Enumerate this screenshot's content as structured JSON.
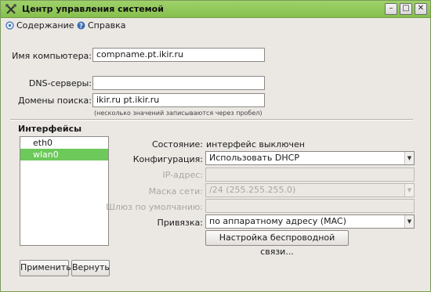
{
  "window": {
    "title": "Центр управления системой",
    "buttons": {
      "minimize": "–",
      "maximize": "□",
      "close": "✕"
    }
  },
  "menu": {
    "items": [
      {
        "label": "Содержание",
        "icon": "contents-icon"
      },
      {
        "label": "Справка",
        "icon": "help-icon"
      }
    ]
  },
  "form": {
    "hostname_label": "Имя компьютера:",
    "hostname_value": "compname.pt.ikir.ru",
    "dns_label": "DNS-серверы:",
    "dns_value": "",
    "search_label": "Домены поиска:",
    "search_value": "ikir.ru pt.ikir.ru",
    "search_hint": "(несколько значений записываются через пробел)"
  },
  "interfaces": {
    "title": "Интерфейсы",
    "items": [
      "eth0",
      "wlan0"
    ],
    "selected_index": 1
  },
  "details": {
    "state_label": "Состояние:",
    "state_value": "интерфейс выключен",
    "config_label": "Конфигурация:",
    "config_value": "Использовать DHCP",
    "ip_label": "IP-адрес:",
    "ip_value": "",
    "mask_label": "Маска сети:",
    "mask_value": "/24 (255.255.255.0)",
    "gateway_label": "Шлюз по умолчанию:",
    "gateway_value": "",
    "binding_label": "Привязка:",
    "binding_value": "по  аппаратному адресу (MAC)",
    "wireless_button": "Настройка беспроводной связи..."
  },
  "actions": {
    "apply": "Применить",
    "revert": "Вернуть"
  },
  "colors": {
    "titlebar": "#8fc75a",
    "selection": "#6cc95a",
    "window_bg": "#ebe8e4"
  }
}
